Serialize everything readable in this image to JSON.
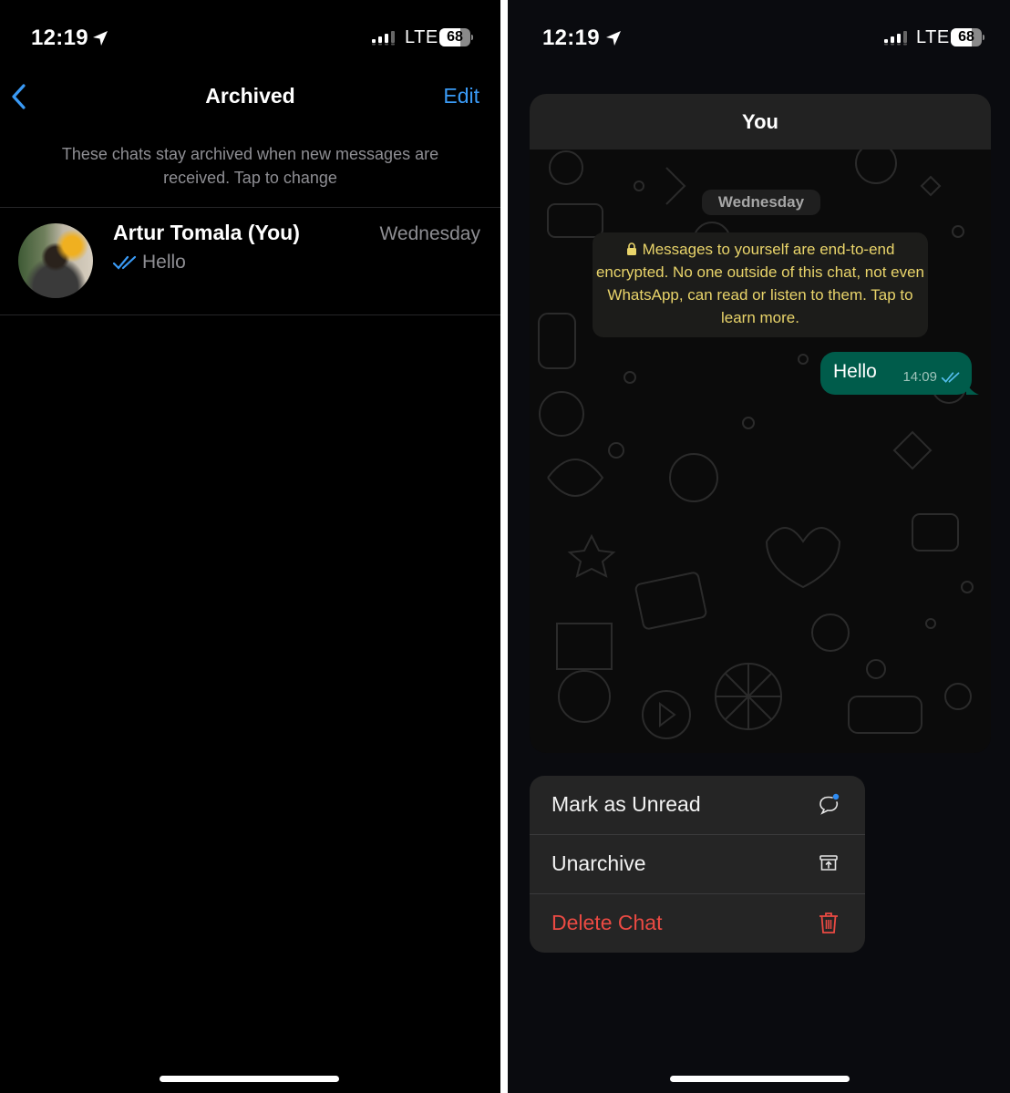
{
  "left_screen": {
    "status_bar": {
      "time": "12:19",
      "network": "LTE",
      "battery": "68",
      "battery_level": 0.68
    },
    "nav": {
      "back_icon": "chevron-left-icon",
      "title": "Archived",
      "edit_label": "Edit"
    },
    "notice": "These chats stay archived when new messages are received. Tap to change",
    "chats": [
      {
        "name": "Artur Tomala (You)",
        "date": "Wednesday",
        "preview": "Hello",
        "status_icon": "double-check-icon"
      }
    ]
  },
  "right_screen": {
    "status_bar": {
      "time": "12:19",
      "network": "LTE",
      "battery": "68",
      "battery_level": 0.68
    },
    "chat_preview": {
      "title": "You",
      "day_label": "Wednesday",
      "encryption_notice": "Messages to yourself are end-to-end encrypted. No one outside of this chat, not even WhatsApp, can read or listen to them. Tap to learn more.",
      "message": {
        "text": "Hello",
        "time": "14:09",
        "status_icon": "double-check-icon"
      }
    },
    "context_menu": {
      "items": [
        {
          "label": "Mark as Unread",
          "icon": "chat-unread-icon"
        },
        {
          "label": "Unarchive",
          "icon": "unarchive-icon"
        },
        {
          "label": "Delete Chat",
          "icon": "trash-icon",
          "destructive": true
        }
      ]
    }
  },
  "colors": {
    "accent_blue": "#3a9af5",
    "bubble_green": "#005c4b",
    "destructive_red": "#eb4a43",
    "encryption_yellow": "#e9d46a"
  }
}
